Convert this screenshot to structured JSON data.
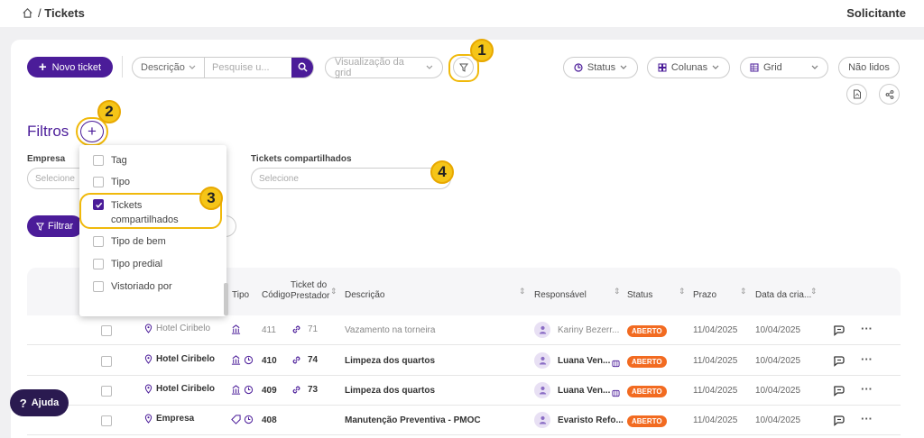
{
  "breadcrumb": {
    "sep": "/",
    "current": "Tickets"
  },
  "header": {
    "role": "Solicitante"
  },
  "toolbar": {
    "new_ticket": "Novo ticket",
    "search_field": "Descrição",
    "search_placeholder": "Pesquise u...",
    "view_placeholder": "Visualização da grid",
    "status": "Status",
    "columns": "Colunas",
    "grid": "Grid",
    "unread": "Não lidos"
  },
  "callouts": [
    "1",
    "2",
    "3",
    "4"
  ],
  "filters": {
    "title": "Filtros",
    "add": "+",
    "empresa_label": "Empresa",
    "empresa_placeholder": "Selecione",
    "shared_label": "Tickets compartilhados",
    "shared_placeholder": "Selecione",
    "apply": "Filtrar"
  },
  "dropdown": {
    "items": [
      {
        "label": "Tag",
        "checked": false
      },
      {
        "label": "Tipo",
        "checked": false
      },
      {
        "label": "Tickets compartilhados",
        "checked": true
      },
      {
        "label": "Tipo de bem",
        "checked": false
      },
      {
        "label": "Tipo predial",
        "checked": false
      },
      {
        "label": "Vistoriado por",
        "checked": false
      }
    ]
  },
  "table": {
    "headers": {
      "tipo": "Tipo",
      "codigo": "Código",
      "ticket_prestador": "Ticket do Prestador",
      "descricao": "Descrição",
      "responsavel": "Responsável",
      "status": "Status",
      "prazo": "Prazo",
      "data_criacao": "Data da cria..."
    },
    "rows": [
      {
        "local": "Hotel Ciribelo",
        "codigo": "411",
        "prestador": "71",
        "descricao": "Vazamento na torneira",
        "responsavel": "Kariny Bezerr...",
        "status": "ABERTO",
        "prazo": "11/04/2025",
        "criacao": "10/04/2025"
      },
      {
        "local": "Hotel Ciribelo",
        "codigo": "410",
        "prestador": "74",
        "descricao": "Limpeza dos quartos",
        "responsavel": "Luana Ven...",
        "status": "ABERTO",
        "prazo": "11/04/2025",
        "criacao": "10/04/2025"
      },
      {
        "local": "Hotel Ciribelo",
        "codigo": "409",
        "prestador": "73",
        "descricao": "Limpeza dos quartos",
        "responsavel": "Luana Ven...",
        "status": "ABERTO",
        "prazo": "11/04/2025",
        "criacao": "10/04/2025"
      },
      {
        "local": "Empresa",
        "codigo": "408",
        "prestador": "",
        "descricao": "Manutenção Preventiva - PMOC",
        "responsavel": "Evaristo Refo...",
        "status": "ABERTO",
        "prazo": "11/04/2025",
        "criacao": "10/04/2025"
      }
    ],
    "more": "···"
  },
  "help": {
    "label": "Ajuda",
    "icon": "?"
  },
  "colors": {
    "primary": "#4b1c99",
    "callout": "#f5c518",
    "badge": "#f26b21"
  }
}
